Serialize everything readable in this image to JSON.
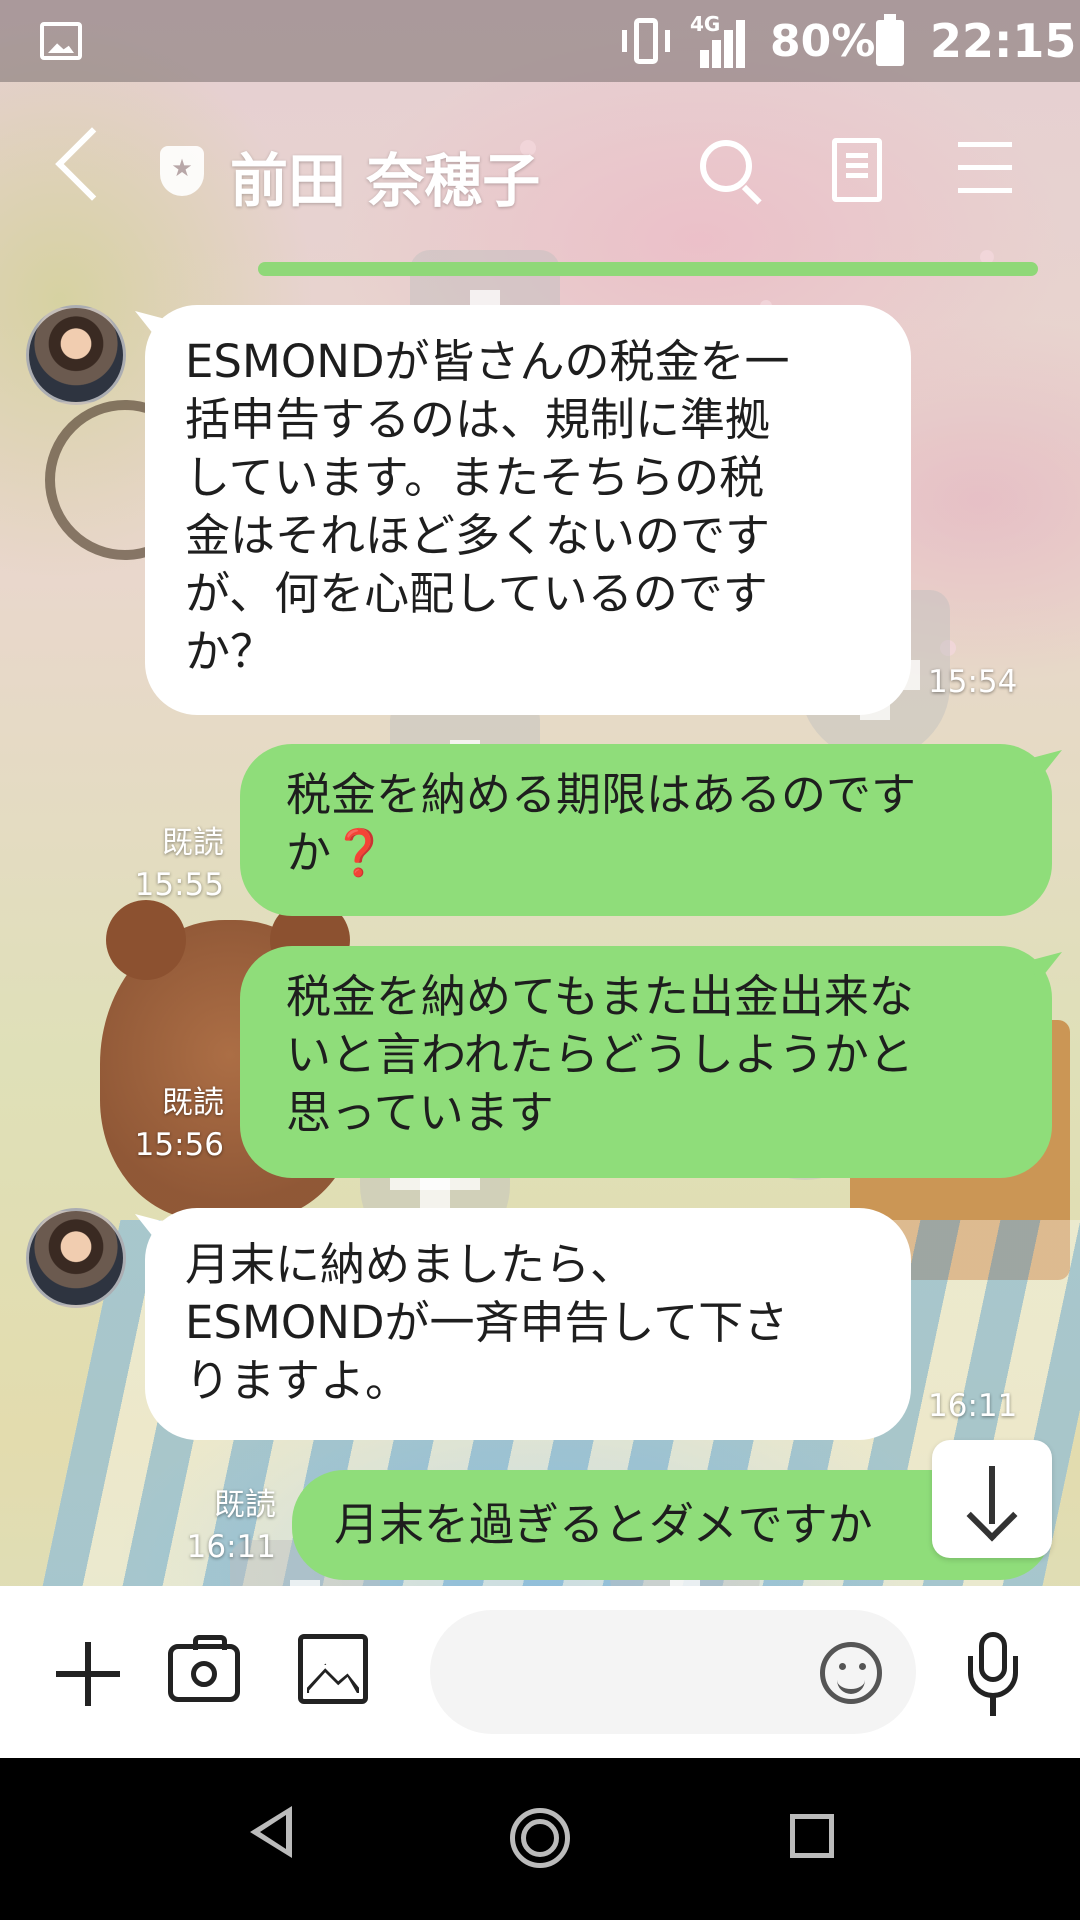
{
  "status_bar": {
    "network": "4G",
    "battery": "80%",
    "time": "22:15"
  },
  "header": {
    "title": "前田 奈穂子"
  },
  "messages": [
    {
      "direction": "incoming",
      "text": "ESMONDが皆さんの税金を一\n括申告するのは、規制に準拠\nしています。またそちらの税\n金はそれほど多くないのです\nが、何を心配しているのです\nか？",
      "time": "15:54"
    },
    {
      "direction": "outgoing",
      "text": "税金を納める期限はあるのです\nか",
      "emoji": "❓",
      "read": "既読",
      "time": "15:55"
    },
    {
      "direction": "outgoing",
      "text": "税金を納めてもまた出金出来な\nいと言われたらどうしようかと\n思っています",
      "read": "既読",
      "time": "15:56"
    },
    {
      "direction": "incoming",
      "text": "月末に納めましたら、\nESMONDが一斉申告して下さ\nりますよ。",
      "time": "16:11"
    },
    {
      "direction": "outgoing",
      "text": "月末を過ぎるとダメですか",
      "read": "既読",
      "time": "16:11"
    }
  ],
  "input": {
    "value": "",
    "placeholder": ""
  },
  "icons": {
    "back": "back-arrow-icon",
    "official": "shield-star-icon",
    "search": "search-icon",
    "notes": "notes-icon",
    "menu": "menu-icon",
    "scroll_down": "arrow-down-icon",
    "plus": "plus-icon",
    "camera": "camera-icon",
    "image": "image-icon",
    "emoji": "emoji-icon",
    "mic": "microphone-icon"
  },
  "colors": {
    "outgoing_bubble": "#8fdd7a",
    "incoming_bubble": "#ffffff",
    "navbar": "#000000"
  }
}
